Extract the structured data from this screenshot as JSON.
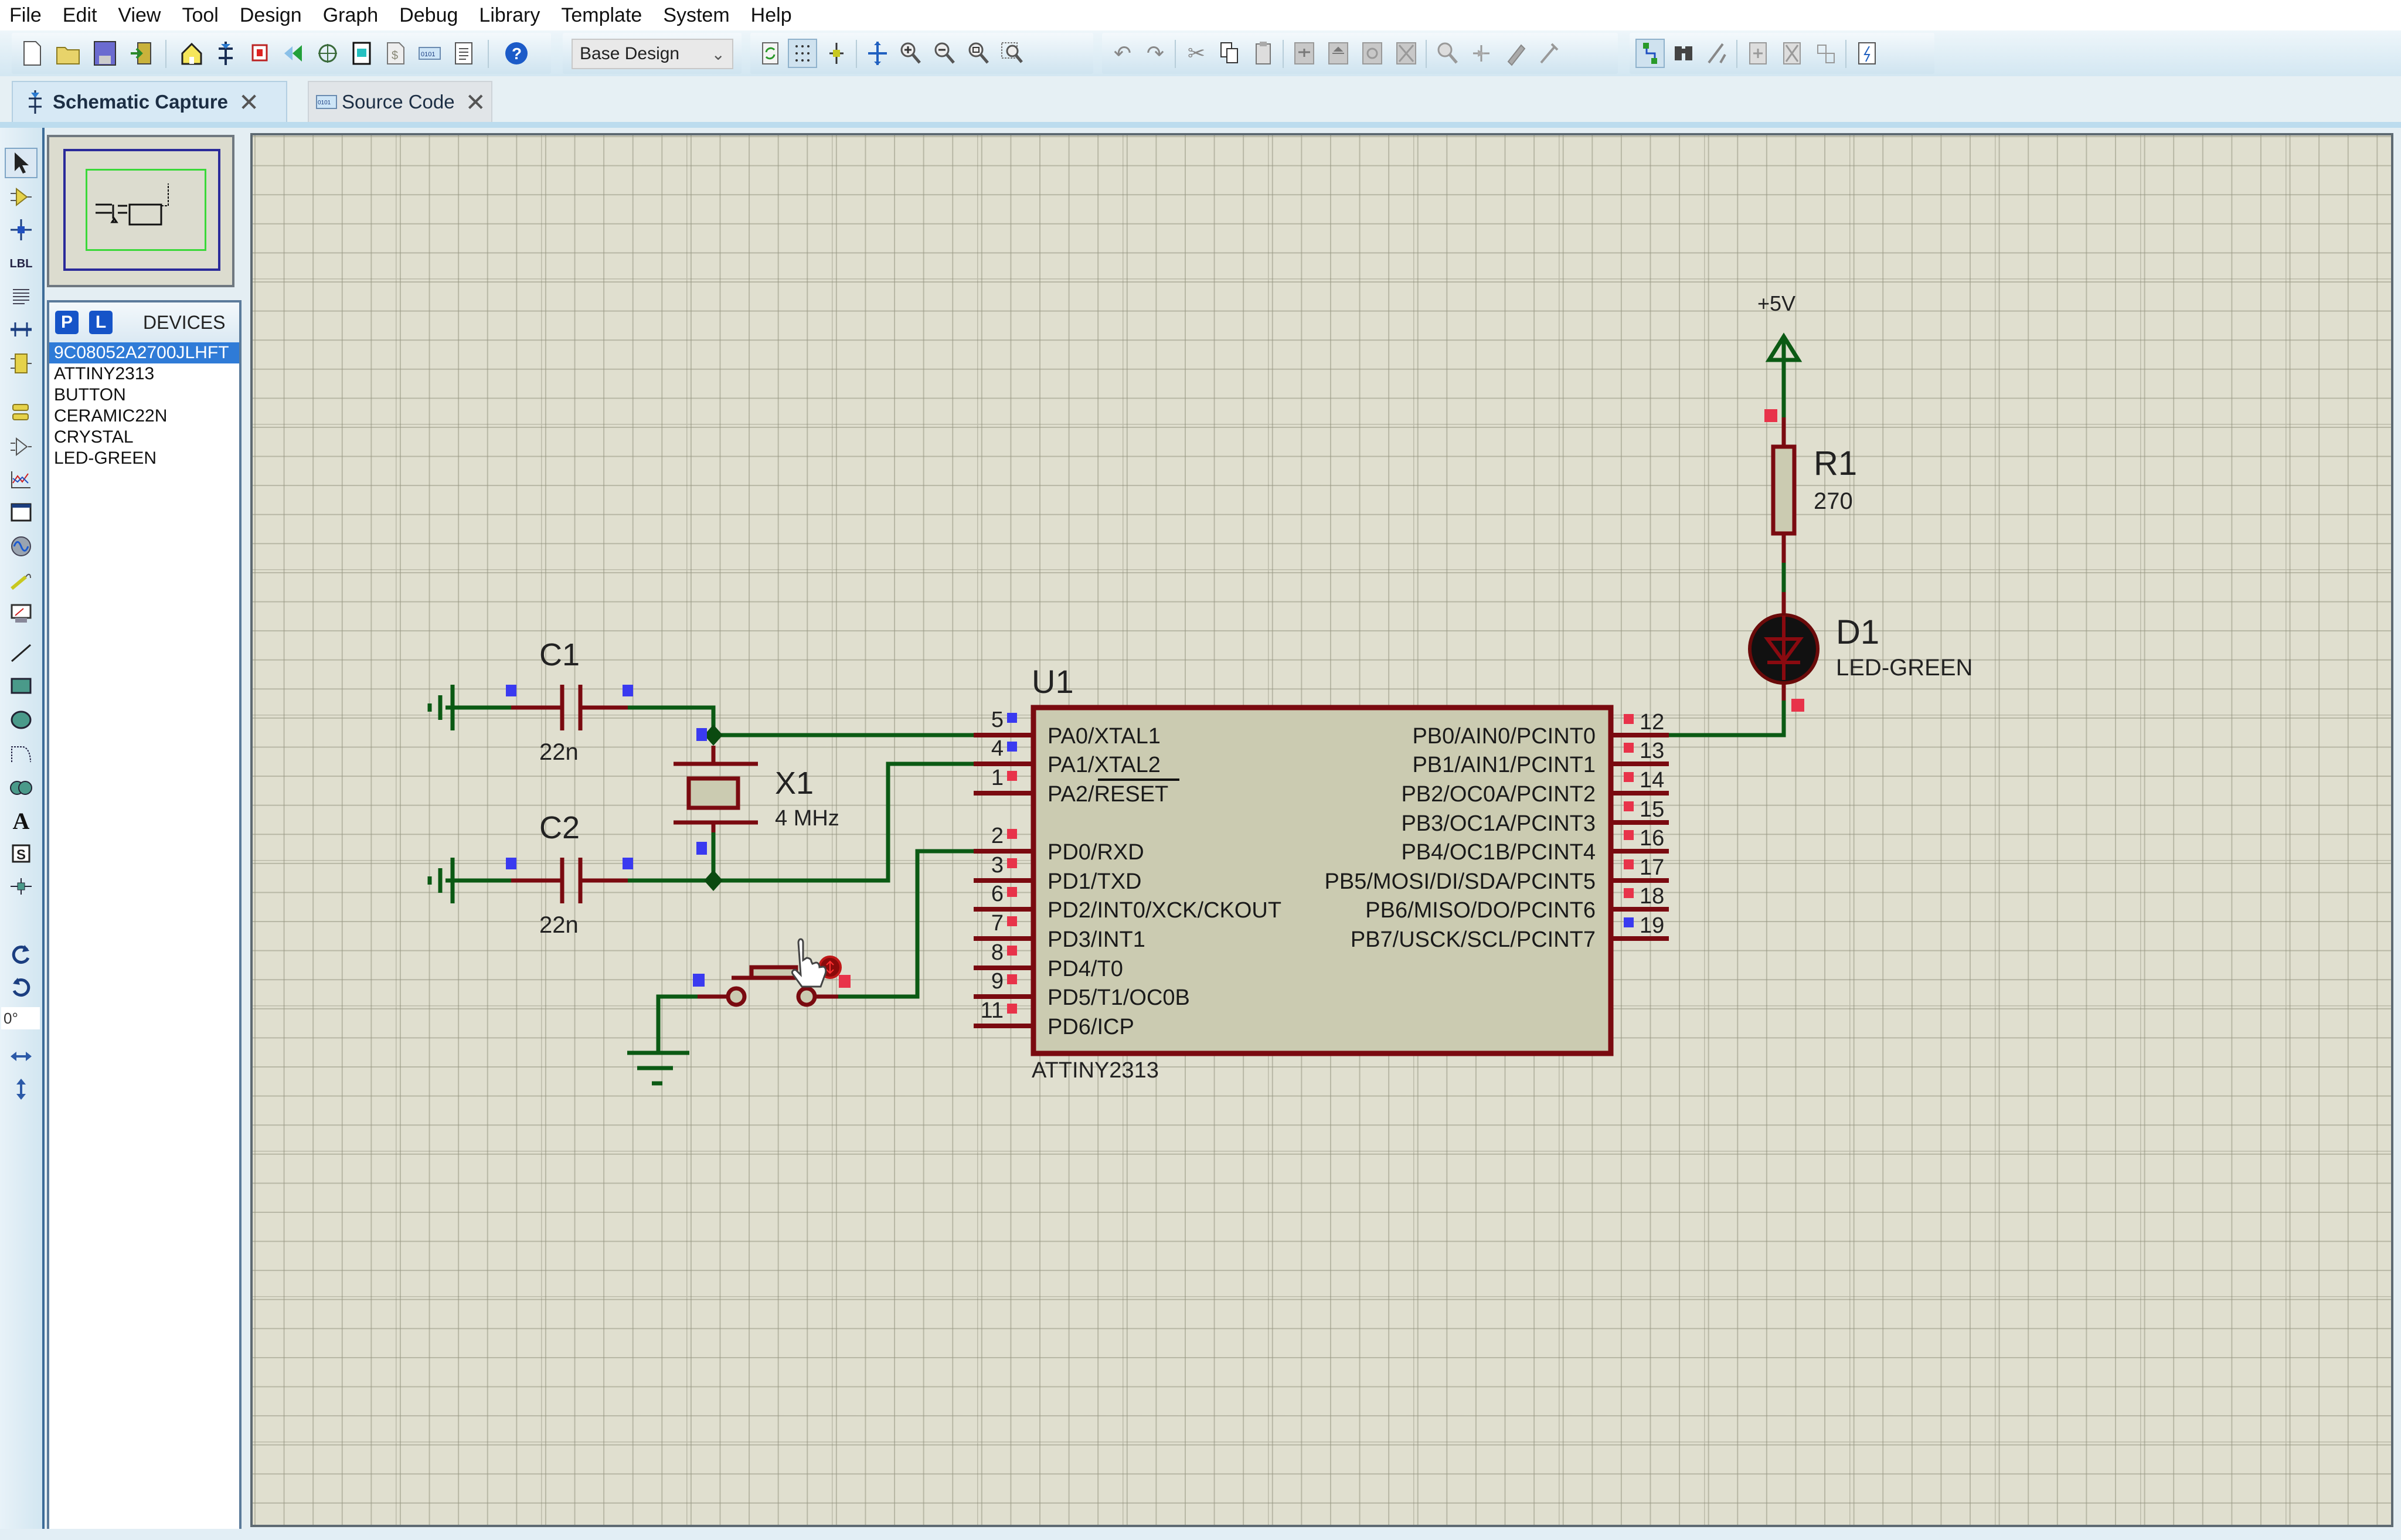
{
  "menu": [
    "File",
    "Edit",
    "View",
    "Tool",
    "Design",
    "Graph",
    "Debug",
    "Library",
    "Template",
    "System",
    "Help"
  ],
  "toolbar": {
    "design_select": "Base Design",
    "file_icons": [
      "new-file-icon",
      "open-folder-icon",
      "save-icon",
      "import-icon"
    ],
    "app_icons": [
      "home-icon",
      "schematic-icon",
      "pcb-icon",
      "3d-visualizer-icon",
      "gerber-icon",
      "bom-icon",
      "design-explorer-icon",
      "source-code-icon",
      "notes-icon",
      "help-icon"
    ],
    "view_icons": [
      "refresh-icon",
      "grid-icon",
      "origin-icon",
      "pan-icon",
      "zoom-in-icon",
      "zoom-out-icon",
      "zoom-all-icon",
      "zoom-area-icon"
    ],
    "edit_icons": [
      "undo-icon",
      "redo-icon",
      "cut-icon",
      "copy-icon",
      "paste-icon",
      "block-copy-icon",
      "block-move-icon",
      "block-rotate-icon",
      "block-delete-icon",
      "pick-device-icon",
      "make-device-icon",
      "packaging-tool-icon",
      "decompose-icon"
    ],
    "tool_icons": [
      "wire-autorouter-icon",
      "search-tag-icon",
      "property-assignment-icon",
      "new-sheet-icon",
      "remove-sheet-icon",
      "goto-sheet-icon",
      "netlist-to-ares-icon"
    ]
  },
  "tabs": [
    {
      "label": "Schematic Capture",
      "active": true
    },
    {
      "label": "Source Code",
      "active": false
    }
  ],
  "left_tools": {
    "rotation_value": "0°"
  },
  "devices": {
    "title": "DEVICES",
    "p_label": "P",
    "l_label": "L",
    "items": [
      "9C08052A2700JLHFT",
      "ATTINY2313",
      "BUTTON",
      "CERAMIC22N",
      "CRYSTAL",
      "LED-GREEN"
    ],
    "selected_index": 0
  },
  "schematic": {
    "power_label": "+5V",
    "components": {
      "C1": {
        "ref": "C1",
        "value": "22n"
      },
      "C2": {
        "ref": "C2",
        "value": "22n"
      },
      "X1": {
        "ref": "X1",
        "value": "4 MHz"
      },
      "R1": {
        "ref": "R1",
        "value": "270"
      },
      "D1": {
        "ref": "D1",
        "value": "LED-GREEN"
      },
      "U1": {
        "ref": "U1",
        "value": "ATTINY2313"
      }
    },
    "u1_left_pins": [
      {
        "num": "5",
        "name": "PA0/XTAL1",
        "state": "blue"
      },
      {
        "num": "4",
        "name": "PA1/XTAL2",
        "state": "blue"
      },
      {
        "num": "1",
        "name": "PA2/RESET",
        "state": "red"
      },
      {
        "num": "2",
        "name": "PD0/RXD",
        "state": "red"
      },
      {
        "num": "3",
        "name": "PD1/TXD",
        "state": "red"
      },
      {
        "num": "6",
        "name": "PD2/INT0/XCK/CKOUT",
        "state": "red"
      },
      {
        "num": "7",
        "name": "PD3/INT1",
        "state": "red"
      },
      {
        "num": "8",
        "name": "PD4/T0",
        "state": "red"
      },
      {
        "num": "9",
        "name": "PD5/T1/OC0B",
        "state": "red"
      },
      {
        "num": "11",
        "name": "PD6/ICP",
        "state": "red"
      }
    ],
    "u1_right_pins": [
      {
        "num": "12",
        "name": "PB0/AIN0/PCINT0",
        "state": "red"
      },
      {
        "num": "13",
        "name": "PB1/AIN1/PCINT1",
        "state": "red"
      },
      {
        "num": "14",
        "name": "PB2/OC0A/PCINT2",
        "state": "red"
      },
      {
        "num": "15",
        "name": "PB3/OC1A/PCINT3",
        "state": "red"
      },
      {
        "num": "16",
        "name": "PB4/OC1B/PCINT4",
        "state": "red"
      },
      {
        "num": "17",
        "name": "PB5/MOSI/DI/SDA/PCINT5",
        "state": "red"
      },
      {
        "num": "18",
        "name": "PB6/MISO/DO/PCINT6",
        "state": "red"
      },
      {
        "num": "19",
        "name": "PB7/USCK/SCL/PCINT7",
        "state": "blue"
      }
    ]
  },
  "colors": {
    "wire": "#0b5a14",
    "component": "#7a0a10",
    "body_fill": "#cbcbb1",
    "pin_red": "#e8334a",
    "pin_blue": "#3a3af0",
    "canvas_bg": "#e0dfcf",
    "selection": "#2f7bd7"
  }
}
